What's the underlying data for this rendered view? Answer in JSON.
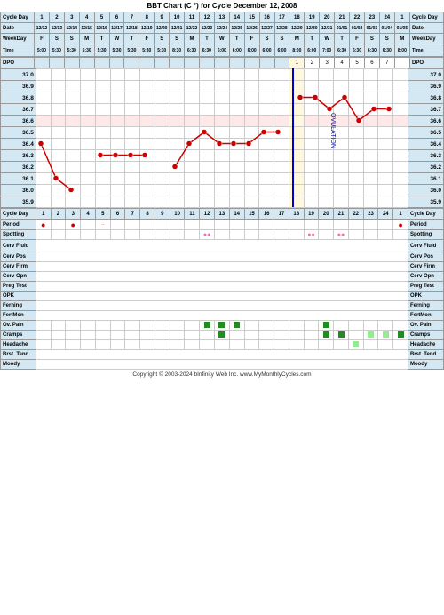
{
  "title": "BBT Chart (C °) for Cycle December 12, 2008",
  "copyright": "Copyright © 2003-2024 bInfinity Web Inc.   www.MyMonthlyCycles.com",
  "header": {
    "cycle_day_label": "Cycle Day",
    "date_label": "Date",
    "weekday_label": "WeekDay",
    "time_label": "Time",
    "dpo_label": "DPO"
  },
  "cycle_days": [
    "1",
    "2",
    "3",
    "4",
    "5",
    "6",
    "7",
    "8",
    "9",
    "10",
    "11",
    "12",
    "13",
    "14",
    "15",
    "16",
    "17",
    "18",
    "19",
    "20",
    "21",
    "22",
    "23",
    "24",
    "1"
  ],
  "dates": [
    "12/12",
    "12/13",
    "12/14",
    "12/15",
    "12/16",
    "12/17",
    "12/18",
    "12/19",
    "12/20",
    "12/21",
    "12/22",
    "12/23",
    "12/24",
    "12/25",
    "12/26",
    "12/27",
    "12/28",
    "12/29",
    "12/30",
    "12/31",
    "01/01",
    "01/02",
    "01/03",
    "01/04",
    "01/05"
  ],
  "weekdays": [
    "F",
    "S",
    "S",
    "M",
    "T",
    "W",
    "T",
    "F",
    "S",
    "S",
    "M",
    "T",
    "W",
    "T",
    "F",
    "S",
    "S",
    "M",
    "T",
    "W",
    "T",
    "F",
    "S",
    "S",
    "M"
  ],
  "times": [
    "5:00",
    "5:30",
    "5:30",
    "5:30",
    "5:30",
    "5:30",
    "5:30",
    "5:30",
    "5:30",
    "8:30",
    "6:30",
    "6:30",
    "6:00",
    "6:00",
    "6:00",
    "6:00",
    "6:00",
    "8:00",
    "6:00",
    "7:00",
    "6:30",
    "6:30",
    "6:30",
    "6:30",
    "8:00"
  ],
  "dpo": [
    "",
    "",
    "",
    "",
    "",
    "",
    "",
    "",
    "",
    "",
    "",
    "",
    "",
    "",
    "",
    "",
    "",
    "1",
    "2",
    "3",
    "4",
    "5",
    "6",
    "7",
    ""
  ],
  "temp_labels": [
    "37.0",
    "36.9",
    "36.8",
    "36.7",
    "36.6",
    "36.5",
    "36.4",
    "36.3",
    "36.2",
    "36.1",
    "36.0",
    "35.9"
  ],
  "section_labels": {
    "period": "Period",
    "spotting": "Spotting",
    "cerv_fluid": "Cerv Fluid",
    "cerv_pos": "Cerv Pos",
    "cerv_firm": "Cerv Firm",
    "cerv_opn": "Cerv Opn",
    "preg_test": "Preg Test",
    "opk": "OPK",
    "ferning": "Ferning",
    "fertmon": "FertMon",
    "ov_pain": "Ov. Pain",
    "cramps": "Cramps",
    "headache": "Headache",
    "brst_tend": "Brst. Tend.",
    "moody": "Moody"
  },
  "colors": {
    "header_bg": "#d4e8f4",
    "ovulation_col_bg": "#fff8dc",
    "ovulation_line": "#0000cc",
    "period_color": "#cc0000",
    "pink": "#ff69b4",
    "green_dark": "#228b22",
    "green_light": "#90ee90",
    "temp_line": "#cc0000"
  }
}
